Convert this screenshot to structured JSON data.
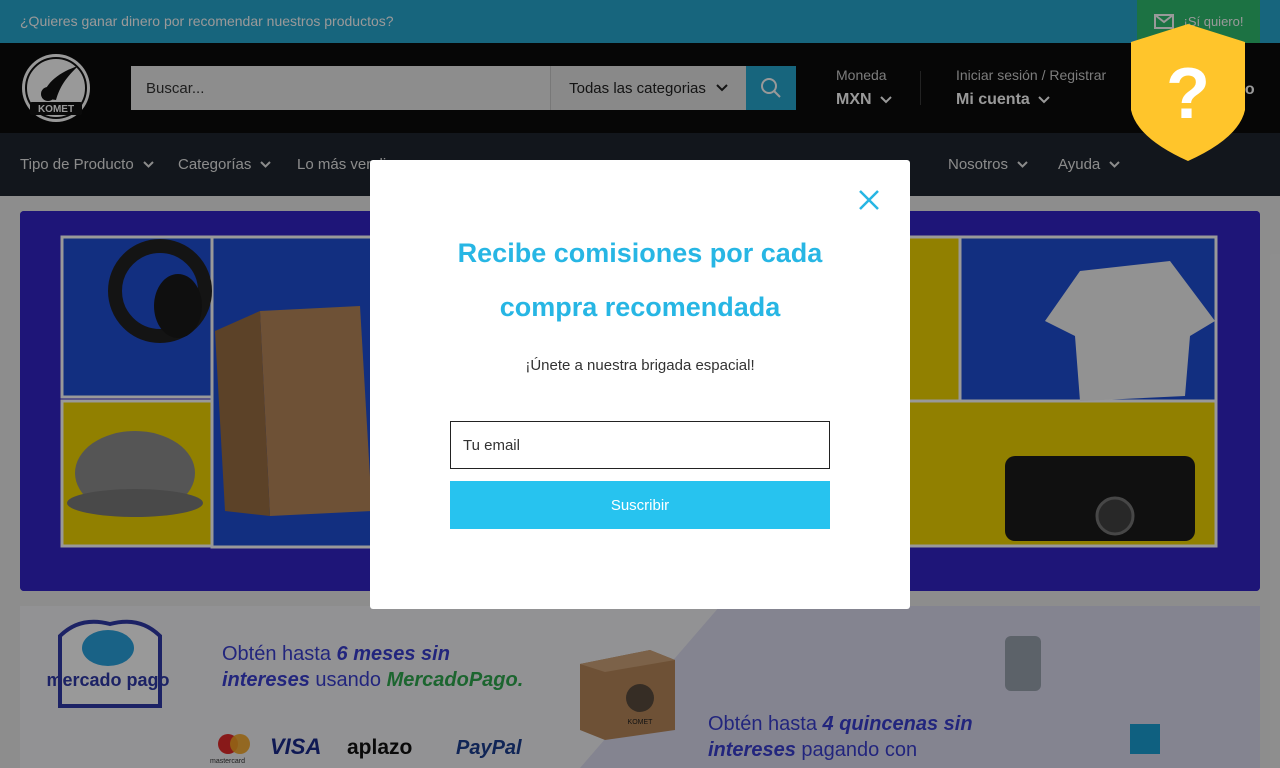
{
  "announcement": {
    "text": "¿Quieres ganar dinero por recomendar nuestros productos?",
    "button_label": "¡Sí quiero!"
  },
  "header": {
    "logo_text": "KOMET",
    "search_placeholder": "Buscar...",
    "category_select": "Todas las categorias",
    "currency_label": "Moneda",
    "currency_value": "MXN",
    "account_label": "Iniciar sesión / Registrar",
    "account_value": "Mi cuenta",
    "cart_label": "co"
  },
  "nav": {
    "items": [
      {
        "label": "Tipo de Producto"
      },
      {
        "label": "Categorías"
      },
      {
        "label": "Lo más vendi"
      },
      {
        "label": "Nosotros"
      },
      {
        "label": "Ayuda"
      }
    ]
  },
  "banner2": {
    "brand": "mercado pago",
    "offer_1a": "Obtén hasta ",
    "offer_1b": "6 meses sin",
    "offer_1c": "intereses",
    "offer_1d": " usando ",
    "offer_1e": "MercadoPago.",
    "offer_2a": "Obtén hasta ",
    "offer_2b": "4 quincenas sin",
    "offer_2c": "intereses",
    "offer_2d": " pagando con",
    "payment_mastercard": "mastercard",
    "payment_visa": "VISA",
    "payment_aplazo": "aplazo",
    "payment_paypal": "PayPal",
    "box_label": "KOMET"
  },
  "modal": {
    "title_line1": "Recibe comisiones por cada",
    "title_line2": "compra recomendada",
    "subtitle": "¡Únete a nuestra brigada espacial!",
    "email_placeholder": "Tu email",
    "submit_label": "Suscribir"
  },
  "help_badge": {
    "symbol": "?"
  },
  "colors": {
    "announce_bg": "#27a8d0",
    "announce_button": "#2fbf71",
    "header_bg": "#0a0a0a",
    "nav_bg": "#1e262f",
    "accent": "#27c3ef",
    "modal_title": "#27b6e4",
    "badge": "#ffc52b"
  }
}
